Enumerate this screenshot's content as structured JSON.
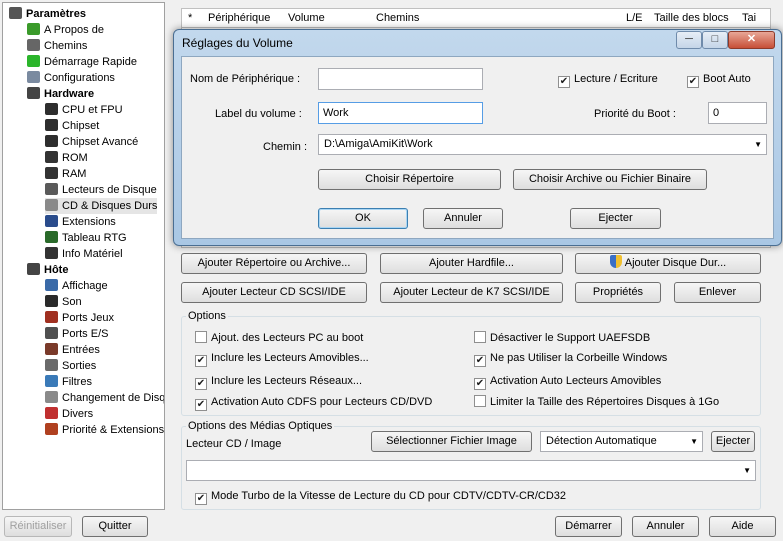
{
  "tree": {
    "items": [
      {
        "label": "Paramètres",
        "icon": "settings-icon",
        "bold": true
      },
      {
        "label": "A Propos de",
        "icon": "checkmark-icon"
      },
      {
        "label": "Chemins",
        "icon": "folder-icon"
      },
      {
        "label": "Démarrage Rapide",
        "icon": "play-icon"
      },
      {
        "label": "Configurations",
        "icon": "config-icon"
      },
      {
        "label": "Hardware",
        "icon": "hardware-icon",
        "bold": true
      },
      {
        "label": "CPU et FPU",
        "icon": "chip-icon"
      },
      {
        "label": "Chipset",
        "icon": "chip-icon"
      },
      {
        "label": "Chipset Avancé",
        "icon": "chip-icon"
      },
      {
        "label": "ROM",
        "icon": "rom-icon"
      },
      {
        "label": "RAM",
        "icon": "ram-icon"
      },
      {
        "label": "Lecteurs de Disque",
        "icon": "floppy-icon"
      },
      {
        "label": "CD & Disques Durs",
        "icon": "cd-icon"
      },
      {
        "label": "Extensions",
        "icon": "expansion-icon"
      },
      {
        "label": "Tableau RTG",
        "icon": "rtg-icon"
      },
      {
        "label": "Info Matériel",
        "icon": "info-icon"
      },
      {
        "label": "Hôte",
        "icon": "host-icon",
        "bold": true
      },
      {
        "label": "Affichage",
        "icon": "display-icon"
      },
      {
        "label": "Son",
        "icon": "sound-icon"
      },
      {
        "label": "Ports Jeux",
        "icon": "joystick-icon"
      },
      {
        "label": "Ports E/S",
        "icon": "io-icon"
      },
      {
        "label": "Entrées",
        "icon": "input-icon"
      },
      {
        "label": "Sorties",
        "icon": "output-icon"
      },
      {
        "label": "Filtres",
        "icon": "filter-icon"
      },
      {
        "label": "Changement de Disque",
        "icon": "swap-icon"
      },
      {
        "label": "Divers",
        "icon": "misc-icon"
      },
      {
        "label": "Priorité & Extensions",
        "icon": "priority-icon"
      }
    ]
  },
  "table": {
    "headers": [
      "*",
      "Périphérique",
      "Volume",
      "Chemins",
      "L/E",
      "Taille des blocs",
      "Tai"
    ]
  },
  "dialog": {
    "title": "Réglages du Volume",
    "device_label": "Nom de Périphérique :",
    "device_value": "",
    "volume_label": "Label du volume :",
    "volume_value": "Work",
    "path_label": "Chemin :",
    "path_value": "D:\\Amiga\\AmiKit\\Work",
    "readwrite": "Lecture / Ecriture",
    "readwrite_checked": true,
    "bootauto": "Boot Auto",
    "bootauto_checked": true,
    "boot_priority_label": "Priorité du Boot :",
    "boot_priority_value": "0",
    "choose_dir": "Choisir Répertoire",
    "choose_archive": "Choisir Archive ou Fichier Binaire",
    "ok": "OK",
    "cancel": "Annuler",
    "eject": "Ejecter"
  },
  "actions": {
    "add_dir": "Ajouter Répertoire ou Archive...",
    "add_hardfile": "Ajouter Hardfile...",
    "add_harddisk": "Ajouter Disque Dur...",
    "add_cd": "Ajouter Lecteur CD SCSI/IDE",
    "add_tape": "Ajouter Lecteur de K7 SCSI/IDE",
    "properties": "Propriétés",
    "remove": "Enlever"
  },
  "options": {
    "title": "Options",
    "items": [
      {
        "label": "Ajout. des Lecteurs PC au boot",
        "checked": false
      },
      {
        "label": "Désactiver le Support UAEFSDB",
        "checked": false
      },
      {
        "label": "Inclure les Lecteurs Amovibles...",
        "checked": true
      },
      {
        "label": "Ne pas Utiliser la Corbeille Windows",
        "checked": true
      },
      {
        "label": "Inclure les Lecteurs Réseaux...",
        "checked": true
      },
      {
        "label": "Activation Auto Lecteurs Amovibles",
        "checked": true
      },
      {
        "label": "Activation Auto CDFS pour Lecteurs CD/DVD",
        "checked": true
      },
      {
        "label": "Limiter la Taille des Répertoires Disques à 1Go",
        "checked": false
      }
    ]
  },
  "optical": {
    "title": "Options des Médias Optiques",
    "cd_label": "Lecteur CD / Image",
    "select_image": "Sélectionner Fichier Image",
    "detect": "Détection Automatique",
    "eject": "Ejecter",
    "image_value": "",
    "turbo": "Mode Turbo de la Vitesse de Lecture du CD pour CDTV/CDTV-CR/CD32",
    "turbo_checked": true
  },
  "bottom": {
    "reset": "Réinitialiser",
    "quit": "Quitter",
    "start": "Démarrer",
    "cancel": "Annuler",
    "help": "Aide"
  }
}
